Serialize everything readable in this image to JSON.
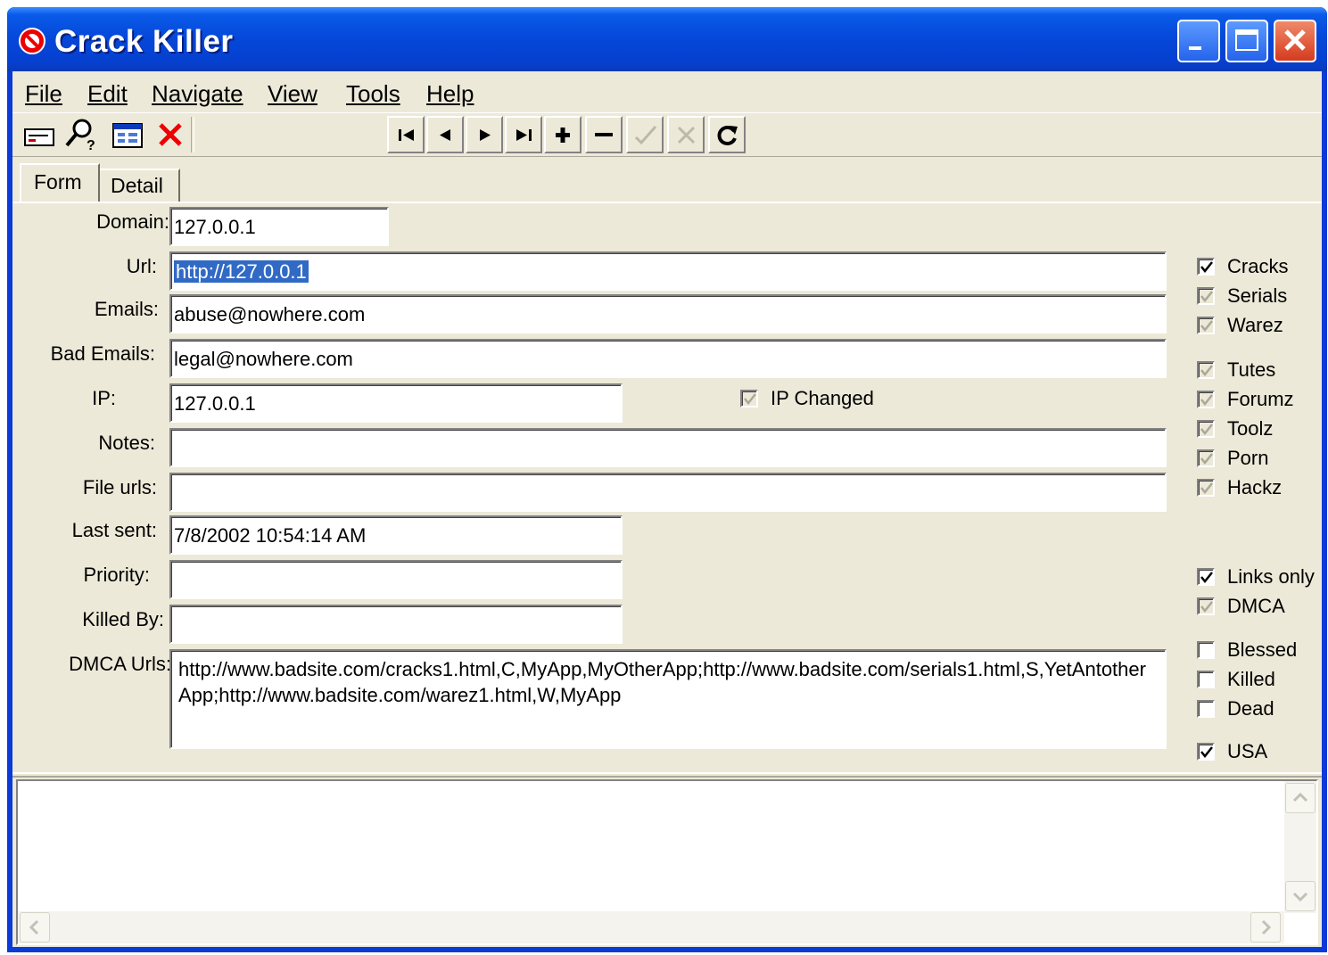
{
  "window": {
    "title": "Crack Killer"
  },
  "menu": {
    "file": "File",
    "edit": "Edit",
    "navigate": "Navigate",
    "view": "View",
    "tools": "Tools",
    "help": "Help"
  },
  "toolbar": {
    "icons": [
      "record-card-icon",
      "find-icon",
      "grid-view-icon",
      "delete-x-icon"
    ],
    "navigator": [
      "first-record-icon",
      "prior-record-icon",
      "next-record-icon",
      "last-record-icon",
      "insert-record-icon",
      "delete-record-icon",
      "post-edit-icon",
      "cancel-edit-icon",
      "refresh-icon"
    ]
  },
  "tabs": {
    "form": "Form",
    "detail": "Detail"
  },
  "form": {
    "domain_label": "Domain:",
    "domain_value": "127.0.0.1",
    "url_label": "Url:",
    "url_value": "http://127.0.0.1",
    "emails_label": "Emails:",
    "emails_value": "abuse@nowhere.com",
    "bad_emails_label": "Bad Emails:",
    "bad_emails_value": "legal@nowhere.com",
    "ip_label": "IP:",
    "ip_value": "127.0.0.1",
    "ip_changed_label": "IP Changed",
    "notes_label": "Notes:",
    "notes_value": "",
    "file_urls_label": "File urls:",
    "file_urls_value": "",
    "last_sent_label": "Last sent:",
    "last_sent_value": "7/8/2002 10:54:14 AM",
    "priority_label": "Priority:",
    "priority_value": "",
    "killed_by_label": "Killed By:",
    "killed_by_value": "",
    "dmca_urls_label": "DMCA Urls:",
    "dmca_urls_value": "http://www.badsite.com/cracks1.html,C,MyApp,MyOtherApp;http://www.badsite.com/serials1.html,S,YetAntotherApp;http://www.badsite.com/warez1.html,W,MyApp"
  },
  "checkboxes": {
    "cracks": "Cracks",
    "serials": "Serials",
    "warez": "Warez",
    "tutes": "Tutes",
    "forumz": "Forumz",
    "toolz": "Toolz",
    "porn": "Porn",
    "hackz": "Hackz",
    "links_only": "Links only",
    "dmca": "DMCA",
    "blessed": "Blessed",
    "killed": "Killed",
    "dead": "Dead",
    "usa": "USA"
  },
  "colors": {
    "titlebar": "#0a5ae8",
    "face": "#ece9d8",
    "selection": "#316ac5",
    "close": "#d43b1e"
  }
}
